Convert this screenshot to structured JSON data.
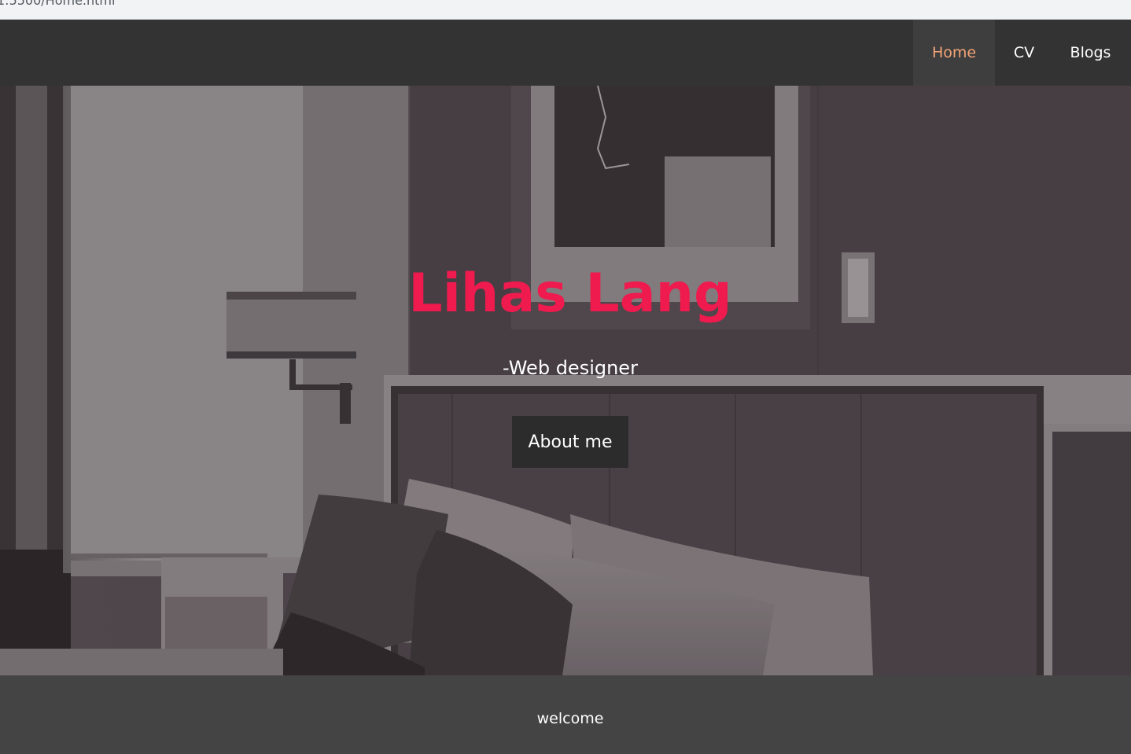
{
  "browser": {
    "url_fragment": "1:5500/Home.html"
  },
  "nav": {
    "items": [
      {
        "label": "Home",
        "active": true
      },
      {
        "label": "CV",
        "active": false
      },
      {
        "label": "Blogs",
        "active": false
      }
    ]
  },
  "hero": {
    "title": "Lihas Lang",
    "subtitle": "-Web designer",
    "button_label": "About me",
    "background_image": "bedroom-photo"
  },
  "footer": {
    "text": "welcome"
  },
  "colors": {
    "navbar": "#343333",
    "nav_active_bg": "#3f3e3e",
    "nav_active_text": "#f2a477",
    "title": "#ef1a4e",
    "button_bg": "#2c2c2c",
    "footer_bg": "#454444"
  }
}
